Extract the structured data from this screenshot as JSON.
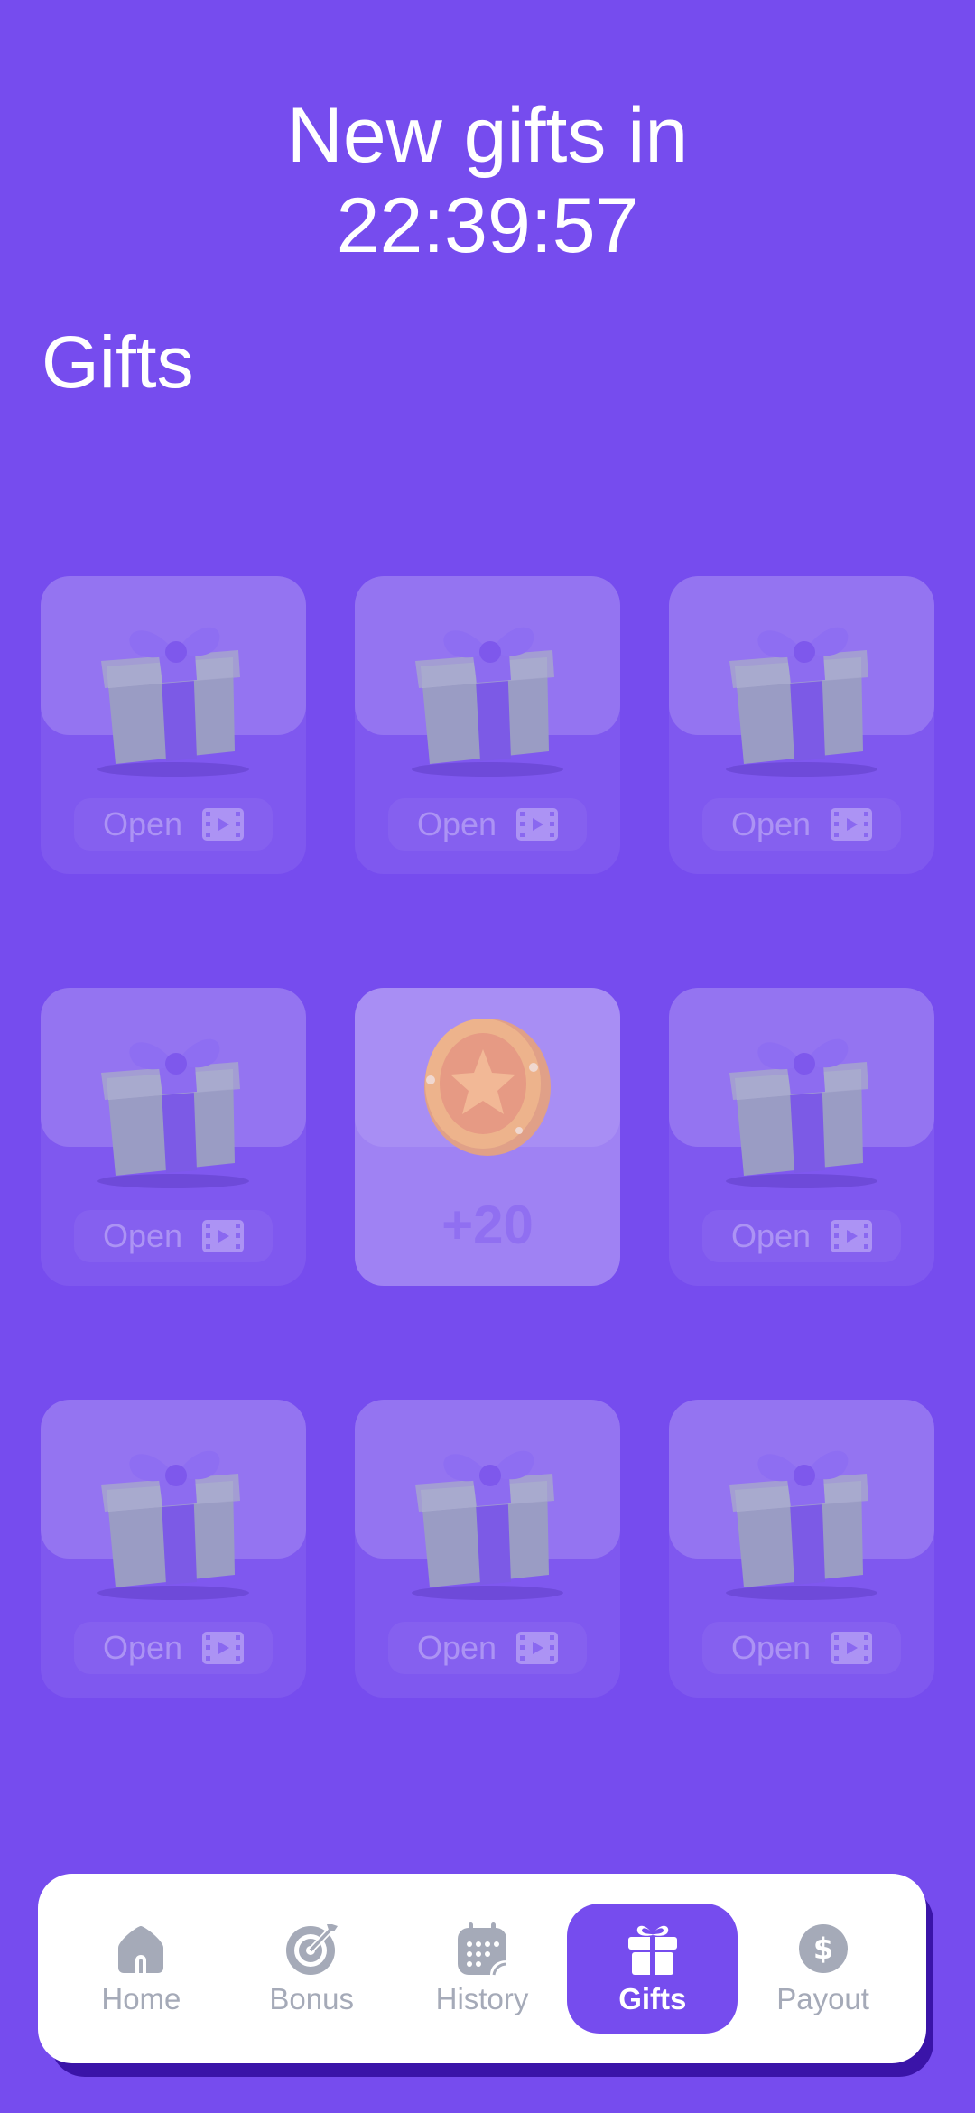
{
  "timer": {
    "line1": "New gifts in",
    "countdown": "22:39:57"
  },
  "section_title": "Gifts",
  "gifts": [
    {
      "state": "closed",
      "label": "Open"
    },
    {
      "state": "closed",
      "label": "Open"
    },
    {
      "state": "closed",
      "label": "Open"
    },
    {
      "state": "closed",
      "label": "Open"
    },
    {
      "state": "opened",
      "reward": "+20"
    },
    {
      "state": "closed",
      "label": "Open"
    },
    {
      "state": "closed",
      "label": "Open"
    },
    {
      "state": "closed",
      "label": "Open"
    },
    {
      "state": "closed",
      "label": "Open"
    }
  ],
  "nav": {
    "items": [
      {
        "label": "Home",
        "icon": "home-icon"
      },
      {
        "label": "Bonus",
        "icon": "target-icon"
      },
      {
        "label": "History",
        "icon": "calendar-icon"
      },
      {
        "label": "Gifts",
        "icon": "gift-icon",
        "active": true
      },
      {
        "label": "Payout",
        "icon": "dollar-icon"
      }
    ]
  },
  "colors": {
    "background": "#764CEE",
    "nav_bg": "#FFFFFF",
    "nav_inactive": "#A5AAB8",
    "accent": "#764CEE"
  }
}
